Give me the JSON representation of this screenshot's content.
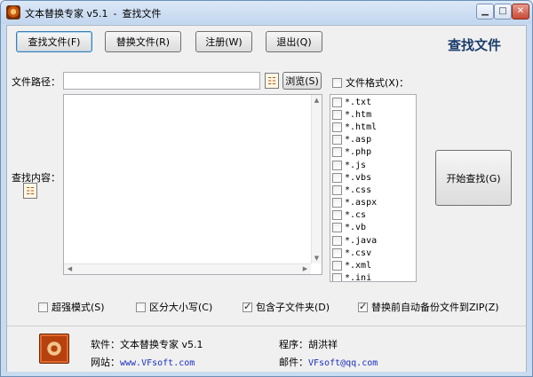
{
  "window": {
    "app_title": "文本替换专家 v5.1",
    "title_separator": "-",
    "mode_title": "查找文件"
  },
  "toolbar": {
    "find_files": "查找文件(F)",
    "replace_files": "替换文件(R)",
    "register": "注册(W)",
    "exit": "退出(Q)"
  },
  "header": {
    "title": "查找文件"
  },
  "path": {
    "label": "文件路径：",
    "value": "",
    "browse": "浏览(S)"
  },
  "content": {
    "label": "查找内容：",
    "value": ""
  },
  "file_format": {
    "label": "文件格式(X)：",
    "checked": false,
    "items": [
      "*.txt",
      "*.htm",
      "*.html",
      "*.asp",
      "*.php",
      "*.js",
      "*.vbs",
      "*.css",
      "*.aspx",
      "*.cs",
      "*.vb",
      "*.java",
      "*.csv",
      "*.xml",
      "*.ini"
    ]
  },
  "start_button": "开始查找(G)",
  "options": {
    "super_mode": {
      "label": "超强模式(S)",
      "checked": false
    },
    "case_sensitive": {
      "label": "区分大小写(C)",
      "checked": false
    },
    "include_subfolders": {
      "label": "包含子文件夹(D)",
      "checked": true
    },
    "backup_zip": {
      "label": "替换前自动备份文件到ZIP(Z)",
      "checked": true
    }
  },
  "footer": {
    "software_label": "软件：",
    "software_value": "文本替换专家 v5.1",
    "website_label": "网站：",
    "website_value": "www.VFsoft.com",
    "author_label": "程序：",
    "author_value": "胡洪祥",
    "email_label": "邮件：",
    "email_value": "VFsoft@qq.com"
  }
}
